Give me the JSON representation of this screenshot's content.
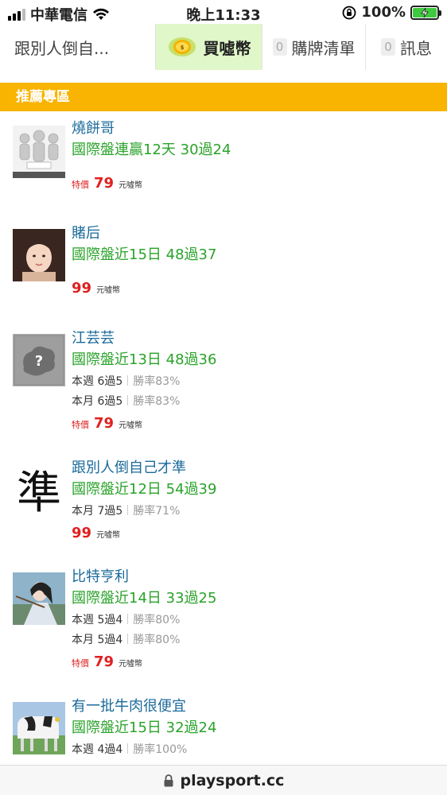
{
  "status_bar": {
    "carrier": "中華電信",
    "time": "晚上11:33",
    "battery_percent": "100%",
    "icons": [
      "signal-icon",
      "wifi-icon",
      "rotation-lock-icon",
      "battery-charging-icon"
    ]
  },
  "tabs": [
    {
      "label": "跟別人倒自..."
    },
    {
      "label": "買噓幣",
      "icon": "coin-icon",
      "active": true
    },
    {
      "label": "購牌清單",
      "count": "0"
    },
    {
      "label": "訊息",
      "count": "0"
    }
  ],
  "section": {
    "title": "推薦專區"
  },
  "items": [
    {
      "name": "燒餅哥",
      "record": "國際盤連贏12天 30過24",
      "price_tag": "特價",
      "price": "79",
      "unit": "元噓幣"
    },
    {
      "name": "賭后",
      "record": "國際盤近15日 48過37",
      "price": "99",
      "unit": "元噓幣"
    },
    {
      "name": "江芸芸",
      "record": "國際盤近13日 48過36",
      "stats": [
        {
          "label": "本週 6過5",
          "rate": "勝率83%"
        },
        {
          "label": "本月 6過5",
          "rate": "勝率83%"
        }
      ],
      "price_tag": "特價",
      "price": "79",
      "unit": "元噓幣"
    },
    {
      "name": "跟別人倒自己才準",
      "record": "國際盤近12日 54過39",
      "stats": [
        {
          "label": "本月 7過5",
          "rate": "勝率71%"
        }
      ],
      "price": "99",
      "unit": "元噓幣",
      "avatar_char": "準"
    },
    {
      "name": "比特亨利",
      "record": "國際盤近14日 33過25",
      "stats": [
        {
          "label": "本週 5過4",
          "rate": "勝率80%"
        },
        {
          "label": "本月 5過4",
          "rate": "勝率80%"
        }
      ],
      "price_tag": "特價",
      "price": "79",
      "unit": "元噓幣"
    },
    {
      "name": "有一批牛肉很便宜",
      "record": "國際盤近15日 32過24",
      "stats": [
        {
          "label": "本週 4過4",
          "rate": "勝率100%"
        }
      ]
    }
  ],
  "url_bar": {
    "url": "playsport.cc",
    "icon": "lock-icon"
  },
  "colors": {
    "section_bg": "#f8b400",
    "name": "#1a6a9a",
    "record": "#2aa32a",
    "price": "#e02020",
    "active_tab": "#dff7c9"
  }
}
